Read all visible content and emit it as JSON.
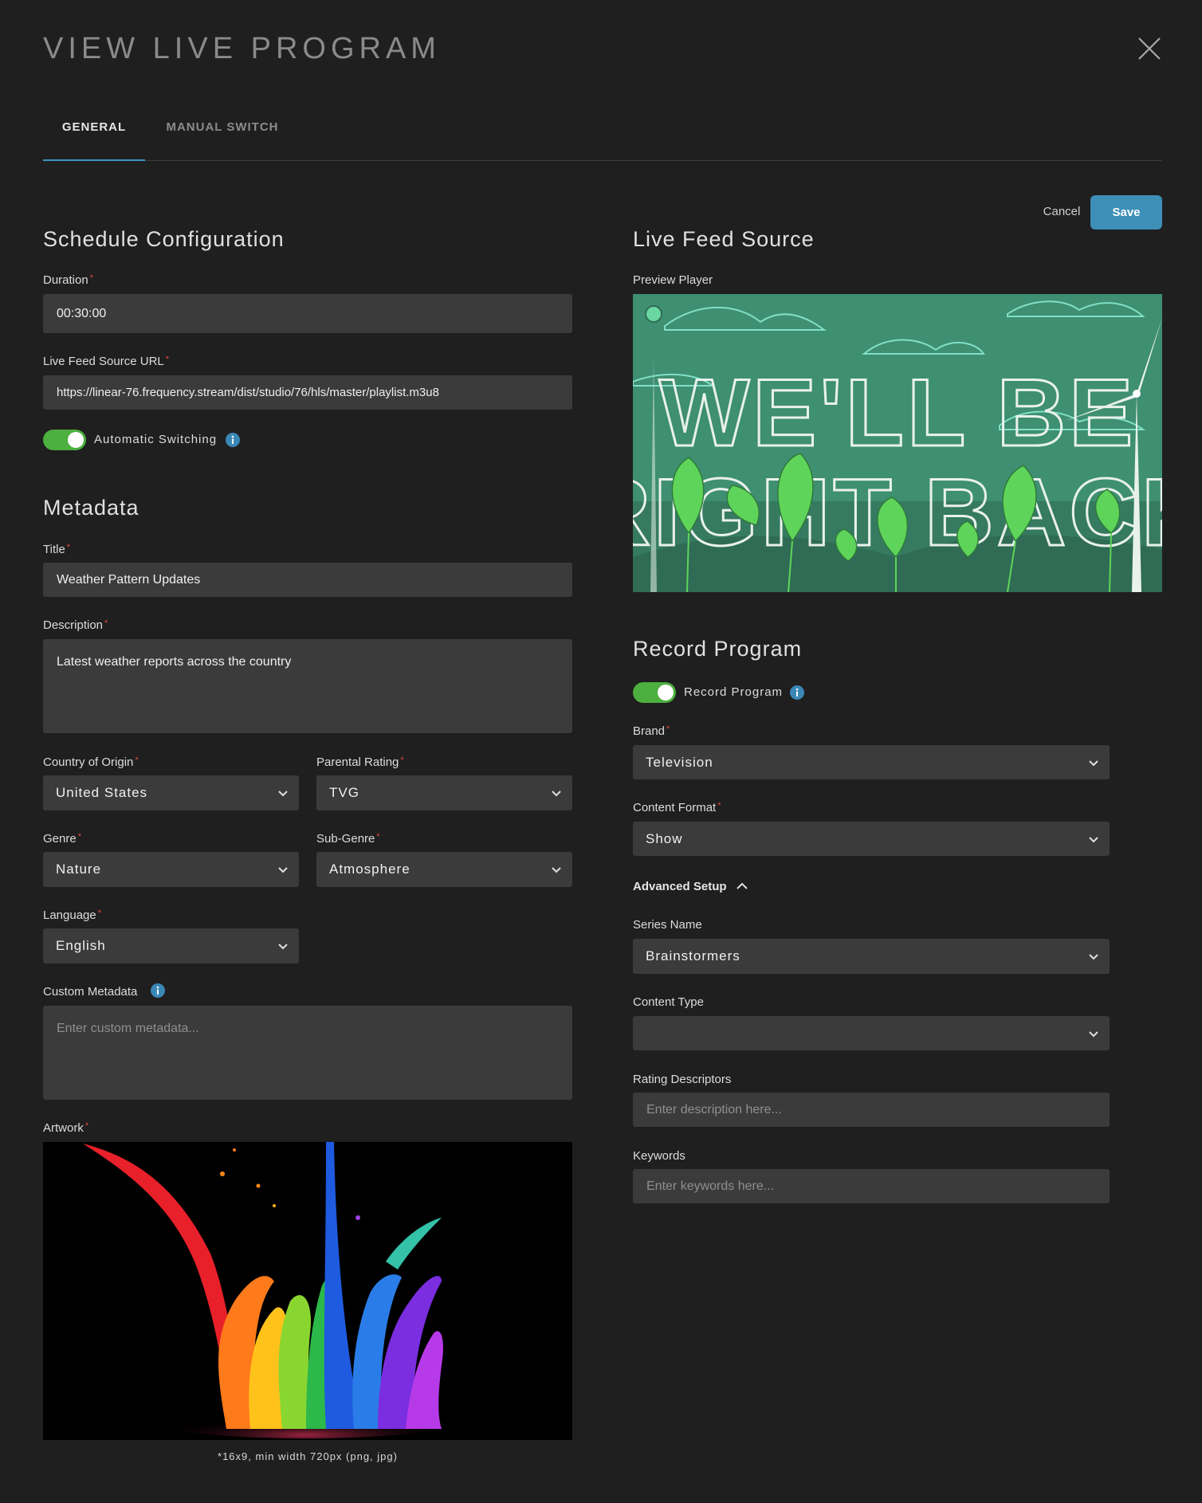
{
  "header": {
    "title": "VIEW LIVE PROGRAM"
  },
  "tabs": [
    {
      "label": "GENERAL",
      "active": true
    },
    {
      "label": "MANUAL SWITCH",
      "active": false
    }
  ],
  "actions": {
    "cancel_label": "Cancel",
    "save_label": "Save"
  },
  "colors": {
    "accent": "#3d8fb8",
    "toggle_on": "#4caf3f",
    "required": "#e04a3a",
    "background": "#1f1f1f",
    "field": "#3b3b3b"
  },
  "schedule": {
    "title": "Schedule Configuration",
    "duration": {
      "label": "Duration",
      "value": "00:30:00"
    },
    "feed_url": {
      "label": "Live Feed Source URL",
      "value": "https://linear-76.frequency.stream/dist/studio/76/hls/master/playlist.m3u8"
    },
    "auto_switch": {
      "label": "Automatic Switching",
      "on": true
    }
  },
  "metadata": {
    "title": "Metadata",
    "program_title": {
      "label": "Title",
      "value": "Weather Pattern Updates"
    },
    "description": {
      "label": "Description",
      "value": "Latest weather reports across the country"
    },
    "country": {
      "label": "Country of Origin",
      "value": "United States"
    },
    "rating": {
      "label": "Parental Rating",
      "value": "TVG"
    },
    "genre": {
      "label": "Genre",
      "value": "Nature"
    },
    "subgenre": {
      "label": "Sub-Genre",
      "value": "Atmosphere"
    },
    "language": {
      "label": "Language",
      "value": "English"
    },
    "custom": {
      "label": "Custom Metadata",
      "placeholder": "Enter custom metadata..."
    },
    "artwork": {
      "label": "Artwork",
      "note": "*16x9, min width 720px (png, jpg)"
    }
  },
  "live_feed": {
    "title": "Live Feed Source",
    "preview_label": "Preview Player",
    "preview_text_line1": "WE'LL BE",
    "preview_text_line2": "RIGHT BACK"
  },
  "record": {
    "title": "Record Program",
    "toggle": {
      "label": "Record Program",
      "on": true
    },
    "brand": {
      "label": "Brand",
      "value": "Television"
    },
    "content_format": {
      "label": "Content Format",
      "value": "Show"
    },
    "advanced_label": "Advanced Setup",
    "series_name": {
      "label": "Series Name",
      "value": "Brainstormers"
    },
    "content_type": {
      "label": "Content Type",
      "value": ""
    },
    "rating_descriptors": {
      "label": "Rating Descriptors",
      "placeholder": "Enter description here..."
    },
    "keywords": {
      "label": "Keywords",
      "placeholder": "Enter keywords here..."
    }
  }
}
